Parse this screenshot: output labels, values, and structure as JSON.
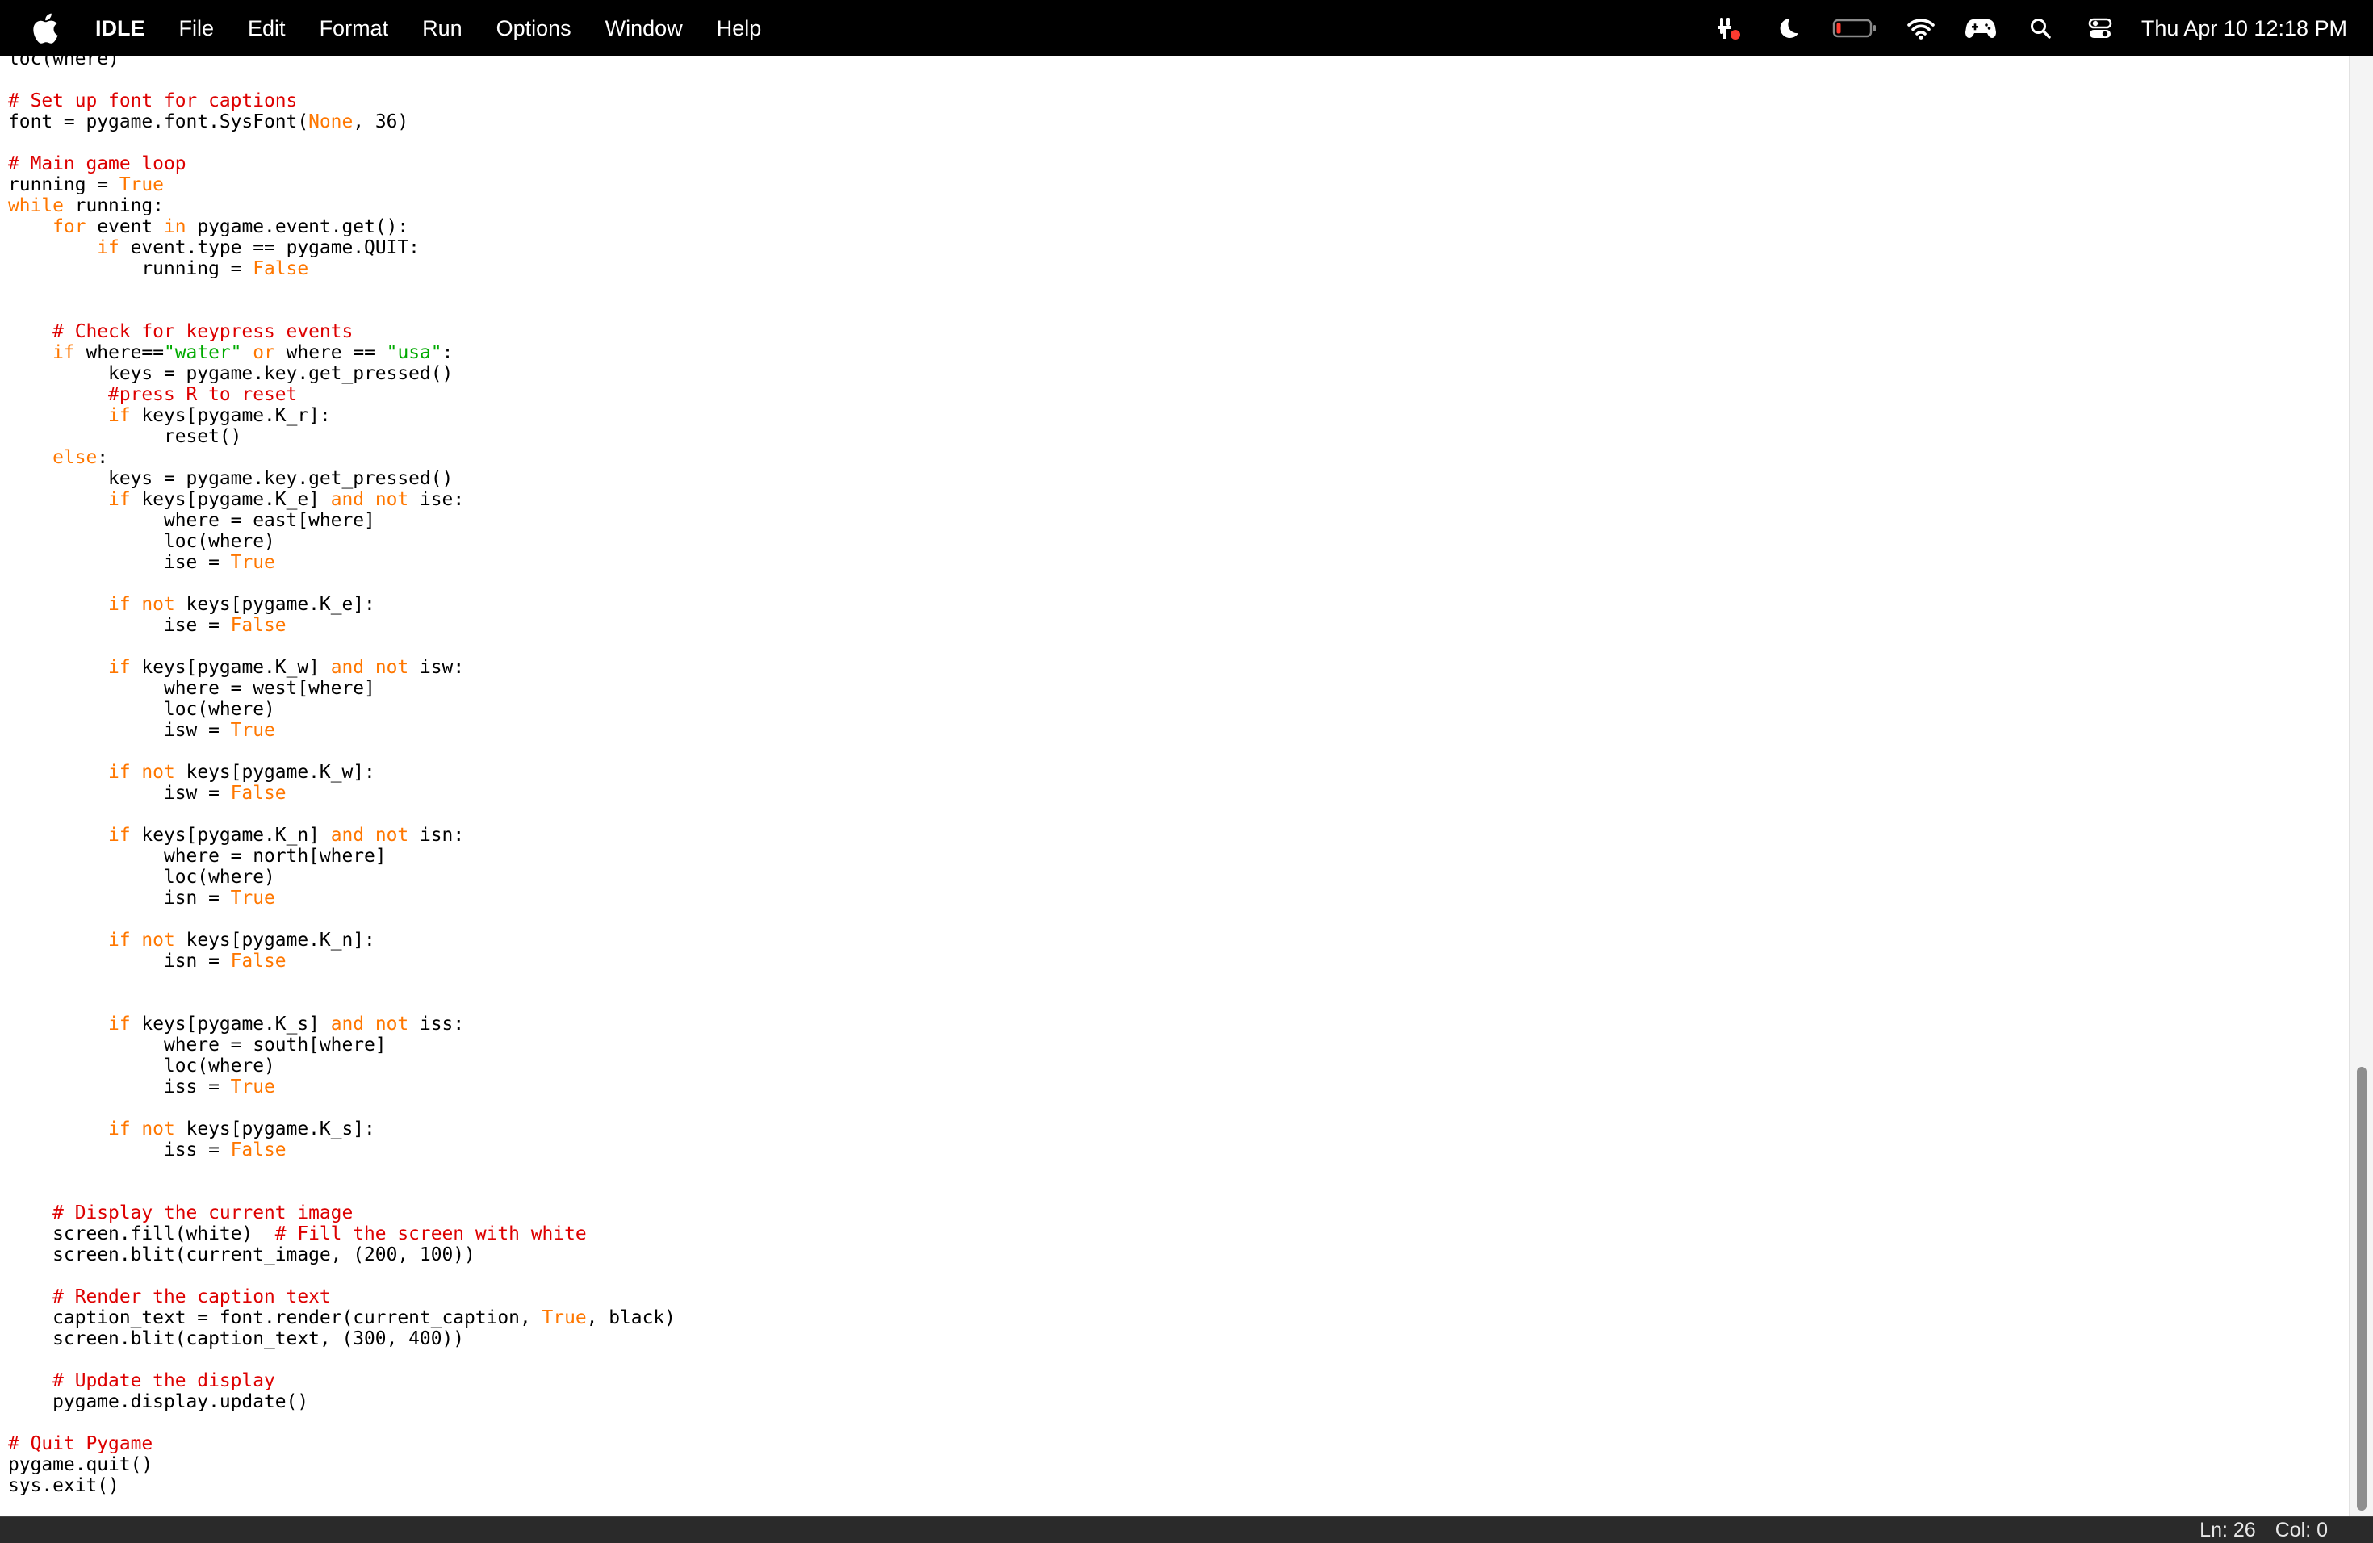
{
  "menubar": {
    "app_name": "IDLE",
    "menus": [
      "File",
      "Edit",
      "Format",
      "Run",
      "Options",
      "Window",
      "Help"
    ],
    "clock": "Thu Apr 10  12:18 PM",
    "status_icons": [
      "recording-tools-icon",
      "moon-icon",
      "battery-icon",
      "wifi-icon",
      "gamepad-icon",
      "search-icon",
      "control-center-icon"
    ]
  },
  "colors": {
    "keyword": "#ff7700",
    "comment": "#dd0000",
    "string": "#00aa00",
    "text": "#000000",
    "menubar_bg": "#000000"
  },
  "editor": {
    "lines": [
      [
        [
          "tx",
          "loc(where)"
        ]
      ],
      [],
      [
        [
          "cm",
          "# Set up font for captions"
        ]
      ],
      [
        [
          "tx",
          "font = pygame.font.SysFont("
        ],
        [
          "kw",
          "None"
        ],
        [
          "tx",
          ", 36)"
        ]
      ],
      [],
      [
        [
          "cm",
          "# Main game loop"
        ]
      ],
      [
        [
          "tx",
          "running = "
        ],
        [
          "kw",
          "True"
        ]
      ],
      [
        [
          "kw",
          "while"
        ],
        [
          "tx",
          " running:"
        ]
      ],
      [
        [
          "tx",
          "    "
        ],
        [
          "kw",
          "for"
        ],
        [
          "tx",
          " event "
        ],
        [
          "kw",
          "in"
        ],
        [
          "tx",
          " pygame.event.get():"
        ]
      ],
      [
        [
          "tx",
          "        "
        ],
        [
          "kw",
          "if"
        ],
        [
          "tx",
          " event.type == pygame.QUIT:"
        ]
      ],
      [
        [
          "tx",
          "            running = "
        ],
        [
          "kw",
          "False"
        ]
      ],
      [],
      [],
      [
        [
          "tx",
          "    "
        ],
        [
          "cm",
          "# Check for keypress events"
        ]
      ],
      [
        [
          "tx",
          "    "
        ],
        [
          "kw",
          "if"
        ],
        [
          "tx",
          " where=="
        ],
        [
          "st",
          "\"water\""
        ],
        [
          "tx",
          " "
        ],
        [
          "kw",
          "or"
        ],
        [
          "tx",
          " where == "
        ],
        [
          "st",
          "\"usa\""
        ],
        [
          "tx",
          ":"
        ]
      ],
      [
        [
          "tx",
          "         keys = pygame.key.get_pressed()"
        ]
      ],
      [
        [
          "tx",
          "         "
        ],
        [
          "cm",
          "#press R to reset"
        ]
      ],
      [
        [
          "tx",
          "         "
        ],
        [
          "kw",
          "if"
        ],
        [
          "tx",
          " keys[pygame.K_r]:"
        ]
      ],
      [
        [
          "tx",
          "              reset()"
        ]
      ],
      [
        [
          "tx",
          "    "
        ],
        [
          "kw",
          "else"
        ],
        [
          "tx",
          ":"
        ]
      ],
      [
        [
          "tx",
          "         keys = pygame.key.get_pressed()"
        ]
      ],
      [
        [
          "tx",
          "         "
        ],
        [
          "kw",
          "if"
        ],
        [
          "tx",
          " keys[pygame.K_e] "
        ],
        [
          "kw",
          "and not"
        ],
        [
          "tx",
          " ise:"
        ]
      ],
      [
        [
          "tx",
          "              where = east[where]"
        ]
      ],
      [
        [
          "tx",
          "              loc(where)"
        ]
      ],
      [
        [
          "tx",
          "              ise = "
        ],
        [
          "kw",
          "True"
        ]
      ],
      [],
      [
        [
          "tx",
          "         "
        ],
        [
          "kw",
          "if not"
        ],
        [
          "tx",
          " keys[pygame.K_e]:"
        ]
      ],
      [
        [
          "tx",
          "              ise = "
        ],
        [
          "kw",
          "False"
        ]
      ],
      [],
      [
        [
          "tx",
          "         "
        ],
        [
          "kw",
          "if"
        ],
        [
          "tx",
          " keys[pygame.K_w] "
        ],
        [
          "kw",
          "and not"
        ],
        [
          "tx",
          " isw:"
        ]
      ],
      [
        [
          "tx",
          "              where = west[where]"
        ]
      ],
      [
        [
          "tx",
          "              loc(where)"
        ]
      ],
      [
        [
          "tx",
          "              isw = "
        ],
        [
          "kw",
          "True"
        ]
      ],
      [],
      [
        [
          "tx",
          "         "
        ],
        [
          "kw",
          "if not"
        ],
        [
          "tx",
          " keys[pygame.K_w]:"
        ]
      ],
      [
        [
          "tx",
          "              isw = "
        ],
        [
          "kw",
          "False"
        ]
      ],
      [],
      [
        [
          "tx",
          "         "
        ],
        [
          "kw",
          "if"
        ],
        [
          "tx",
          " keys[pygame.K_n] "
        ],
        [
          "kw",
          "and not"
        ],
        [
          "tx",
          " isn:"
        ]
      ],
      [
        [
          "tx",
          "              where = north[where]"
        ]
      ],
      [
        [
          "tx",
          "              loc(where)"
        ]
      ],
      [
        [
          "tx",
          "              isn = "
        ],
        [
          "kw",
          "True"
        ]
      ],
      [],
      [
        [
          "tx",
          "         "
        ],
        [
          "kw",
          "if not"
        ],
        [
          "tx",
          " keys[pygame.K_n]:"
        ]
      ],
      [
        [
          "tx",
          "              isn = "
        ],
        [
          "kw",
          "False"
        ]
      ],
      [],
      [],
      [
        [
          "tx",
          "         "
        ],
        [
          "kw",
          "if"
        ],
        [
          "tx",
          " keys[pygame.K_s] "
        ],
        [
          "kw",
          "and not"
        ],
        [
          "tx",
          " iss:"
        ]
      ],
      [
        [
          "tx",
          "              where = south[where]"
        ]
      ],
      [
        [
          "tx",
          "              loc(where)"
        ]
      ],
      [
        [
          "tx",
          "              iss = "
        ],
        [
          "kw",
          "True"
        ]
      ],
      [],
      [
        [
          "tx",
          "         "
        ],
        [
          "kw",
          "if not"
        ],
        [
          "tx",
          " keys[pygame.K_s]:"
        ]
      ],
      [
        [
          "tx",
          "              iss = "
        ],
        [
          "kw",
          "False"
        ]
      ],
      [],
      [],
      [
        [
          "tx",
          "    "
        ],
        [
          "cm",
          "# Display the current image"
        ]
      ],
      [
        [
          "tx",
          "    screen.fill(white)  "
        ],
        [
          "cm",
          "# Fill the screen with white"
        ]
      ],
      [
        [
          "tx",
          "    screen.blit(current_image, (200, 100))"
        ]
      ],
      [],
      [
        [
          "tx",
          "    "
        ],
        [
          "cm",
          "# Render the caption text"
        ]
      ],
      [
        [
          "tx",
          "    caption_text = font.render(current_caption, "
        ],
        [
          "kw",
          "True"
        ],
        [
          "tx",
          ", black)"
        ]
      ],
      [
        [
          "tx",
          "    screen.blit(caption_text, (300, 400))"
        ]
      ],
      [],
      [
        [
          "tx",
          "    "
        ],
        [
          "cm",
          "# Update the display"
        ]
      ],
      [
        [
          "tx",
          "    pygame.display.update()"
        ]
      ],
      [],
      [
        [
          "cm",
          "# Quit Pygame"
        ]
      ],
      [
        [
          "tx",
          "pygame.quit()"
        ]
      ],
      [
        [
          "tx",
          "sys.exit()"
        ]
      ]
    ]
  },
  "statusbar": {
    "line": "Ln: 26",
    "col": "Col: 0"
  }
}
